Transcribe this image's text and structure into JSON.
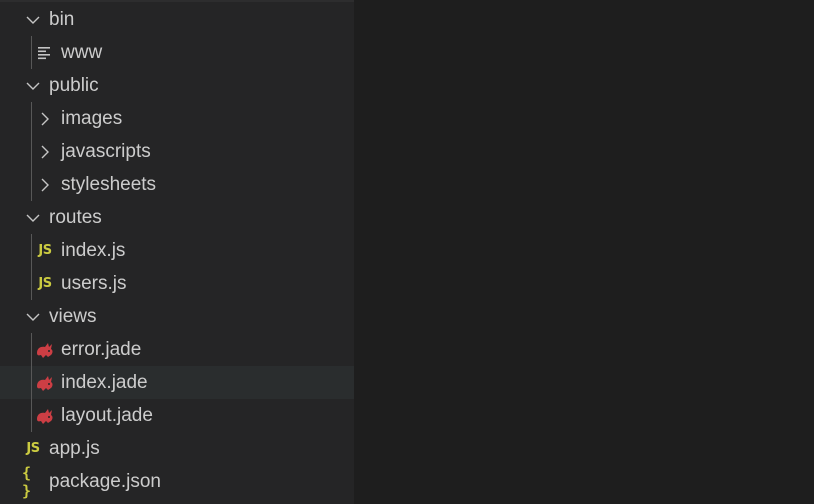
{
  "explorer": {
    "items": [
      {
        "label": "bin",
        "kind": "folder",
        "depth": 0,
        "expanded": true,
        "icon": "chevron-down-icon"
      },
      {
        "label": "www",
        "kind": "file",
        "depth": 1,
        "icon": "text-lines-icon"
      },
      {
        "label": "public",
        "kind": "folder",
        "depth": 0,
        "expanded": true,
        "icon": "chevron-down-icon"
      },
      {
        "label": "images",
        "kind": "folder",
        "depth": 1,
        "expanded": false,
        "icon": "chevron-right-icon"
      },
      {
        "label": "javascripts",
        "kind": "folder",
        "depth": 1,
        "expanded": false,
        "icon": "chevron-right-icon"
      },
      {
        "label": "stylesheets",
        "kind": "folder",
        "depth": 1,
        "expanded": false,
        "icon": "chevron-right-icon"
      },
      {
        "label": "routes",
        "kind": "folder",
        "depth": 0,
        "expanded": true,
        "icon": "chevron-down-icon"
      },
      {
        "label": "index.js",
        "kind": "file",
        "depth": 1,
        "icon": "js-icon"
      },
      {
        "label": "users.js",
        "kind": "file",
        "depth": 1,
        "icon": "js-icon"
      },
      {
        "label": "views",
        "kind": "folder",
        "depth": 0,
        "expanded": true,
        "icon": "chevron-down-icon"
      },
      {
        "label": "error.jade",
        "kind": "file",
        "depth": 1,
        "icon": "jade-icon"
      },
      {
        "label": "index.jade",
        "kind": "file",
        "depth": 1,
        "icon": "jade-icon",
        "hovered": true
      },
      {
        "label": "layout.jade",
        "kind": "file",
        "depth": 1,
        "icon": "jade-icon"
      },
      {
        "label": "app.js",
        "kind": "file",
        "depth": 0,
        "icon": "js-icon"
      },
      {
        "label": "package.json",
        "kind": "file",
        "depth": 0,
        "icon": "json-icon"
      }
    ],
    "icon_glyphs": {
      "js": "JS",
      "json": "{ }"
    },
    "colors": {
      "background": "#252526",
      "editor_background": "#1e1e1e",
      "hover_row": "#2a2d2e",
      "text": "#cccccc",
      "js_icon": "#cbcb41",
      "jade_icon": "#cc3e44"
    }
  }
}
